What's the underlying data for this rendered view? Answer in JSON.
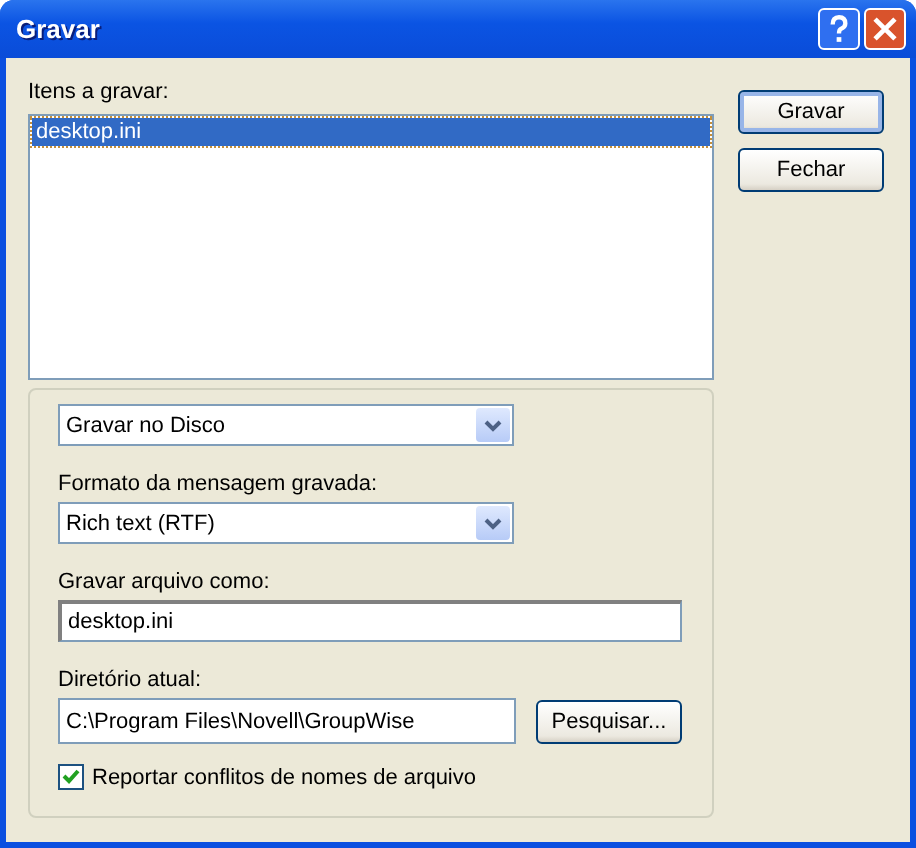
{
  "window": {
    "title": "Gravar"
  },
  "items_label": "Itens a gravar:",
  "items": [
    {
      "name": "desktop.ini",
      "selected": true
    }
  ],
  "buttons": [
    "Gravar",
    "Fechar"
  ],
  "destination": {
    "value": "Gravar no Disco"
  },
  "format": {
    "label": "Formato da mensagem gravada:",
    "value": "Rich text (RTF)"
  },
  "save_as": {
    "label": "Gravar arquivo como:",
    "value": "desktop.ini"
  },
  "directory": {
    "label": "Diretório atual:",
    "value": "C:\\Program Files\\Novell\\GroupWise",
    "button": "Pesquisar..."
  },
  "report_conflicts": {
    "label": "Reportar conflitos de nomes de arquivo",
    "checked": true
  }
}
